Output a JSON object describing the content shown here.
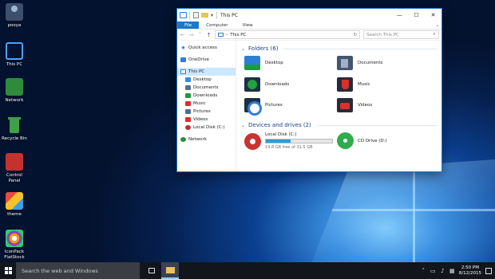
{
  "desktop": {
    "icons": [
      {
        "label": "pooya",
        "icon": "user-icon"
      },
      {
        "label": "This PC",
        "icon": "this-pc-icon"
      },
      {
        "label": "Network",
        "icon": "network-icon"
      },
      {
        "label": "Recycle Bin",
        "icon": "recycle-bin-icon"
      },
      {
        "label": "Control Panel",
        "icon": "control-panel-icon"
      },
      {
        "label": "theme",
        "icon": "theme-icon"
      },
      {
        "label": "IconPack FlatStock",
        "icon": "iconpack-icon"
      }
    ]
  },
  "window": {
    "title": "This PC",
    "controls": {
      "minimize": "—",
      "maximize": "☐",
      "close": "✕"
    },
    "ribbon": {
      "file": "File",
      "computer": "Computer",
      "view": "View",
      "expand": "⌄"
    },
    "address": {
      "path": "This PC",
      "separator": "›"
    },
    "search": {
      "placeholder": "Search This PC"
    },
    "nav_pane": [
      {
        "label": "Quick access",
        "icon": "star-icon"
      },
      {
        "label": "OneDrive",
        "icon": "onedrive-icon"
      },
      {
        "label": "This PC",
        "icon": "this-pc-icon"
      },
      {
        "label": "Desktop",
        "icon": "desktop-folder-icon"
      },
      {
        "label": "Documents",
        "icon": "documents-folder-icon"
      },
      {
        "label": "Downloads",
        "icon": "downloads-folder-icon"
      },
      {
        "label": "Music",
        "icon": "music-folder-icon"
      },
      {
        "label": "Pictures",
        "icon": "pictures-folder-icon"
      },
      {
        "label": "Videos",
        "icon": "videos-folder-icon"
      },
      {
        "label": "Local Disk (C:)",
        "icon": "local-disk-icon"
      },
      {
        "label": "Network",
        "icon": "network-icon"
      }
    ],
    "folders_header": "Folders (6)",
    "folders": [
      {
        "label": "Desktop",
        "icon": "desktop-folder-icon"
      },
      {
        "label": "Documents",
        "icon": "documents-folder-icon"
      },
      {
        "label": "Downloads",
        "icon": "downloads-folder-icon"
      },
      {
        "label": "Music",
        "icon": "music-folder-icon"
      },
      {
        "label": "Pictures",
        "icon": "pictures-folder-icon"
      },
      {
        "label": "Videos",
        "icon": "videos-folder-icon"
      }
    ],
    "drives_header": "Devices and drives (2)",
    "drives": [
      {
        "label": "Local Disk (C:)",
        "free_text": "19.8 GB free of 31.5 GB",
        "used_fraction": 0.37
      },
      {
        "label": "CD Drive (D:)"
      }
    ]
  },
  "taskbar": {
    "search_placeholder": "Search the web and Windows",
    "time": "2:50 PM",
    "date": "8/12/2015"
  }
}
